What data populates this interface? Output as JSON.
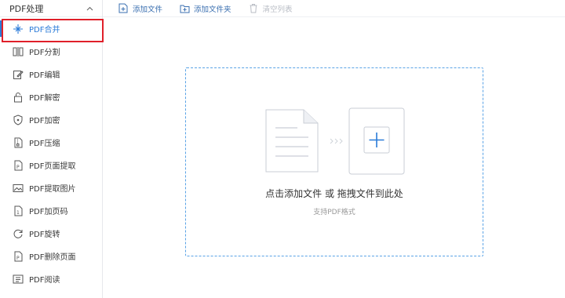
{
  "sidebar": {
    "header_title": "PDF处理",
    "items": [
      {
        "label": "PDF合并",
        "icon": "merge-icon"
      },
      {
        "label": "PDF分割",
        "icon": "split-icon"
      },
      {
        "label": "PDF编辑",
        "icon": "edit-icon"
      },
      {
        "label": "PDF解密",
        "icon": "unlock-icon"
      },
      {
        "label": "PDF加密",
        "icon": "shield-icon"
      },
      {
        "label": "PDF压缩",
        "icon": "compress-icon"
      },
      {
        "label": "PDF页面提取",
        "icon": "extract-page-icon"
      },
      {
        "label": "PDF提取图片",
        "icon": "image-icon"
      },
      {
        "label": "PDF加页码",
        "icon": "page-number-icon"
      },
      {
        "label": "PDF旋转",
        "icon": "rotate-icon"
      },
      {
        "label": "PDF删除页面",
        "icon": "delete-page-icon"
      },
      {
        "label": "PDF阅读",
        "icon": "read-icon"
      }
    ],
    "active_index": 0
  },
  "toolbar": {
    "add_file_label": "添加文件",
    "add_folder_label": "添加文件夹",
    "clear_list_label": "清空列表"
  },
  "dropzone": {
    "main_text": "点击添加文件 或 拖拽文件到此处",
    "sub_text": "支持PDF格式"
  },
  "colors": {
    "accent": "#2a7bd8",
    "highlight_border": "#e0202a",
    "dropzone_border": "#5aa3e6"
  }
}
